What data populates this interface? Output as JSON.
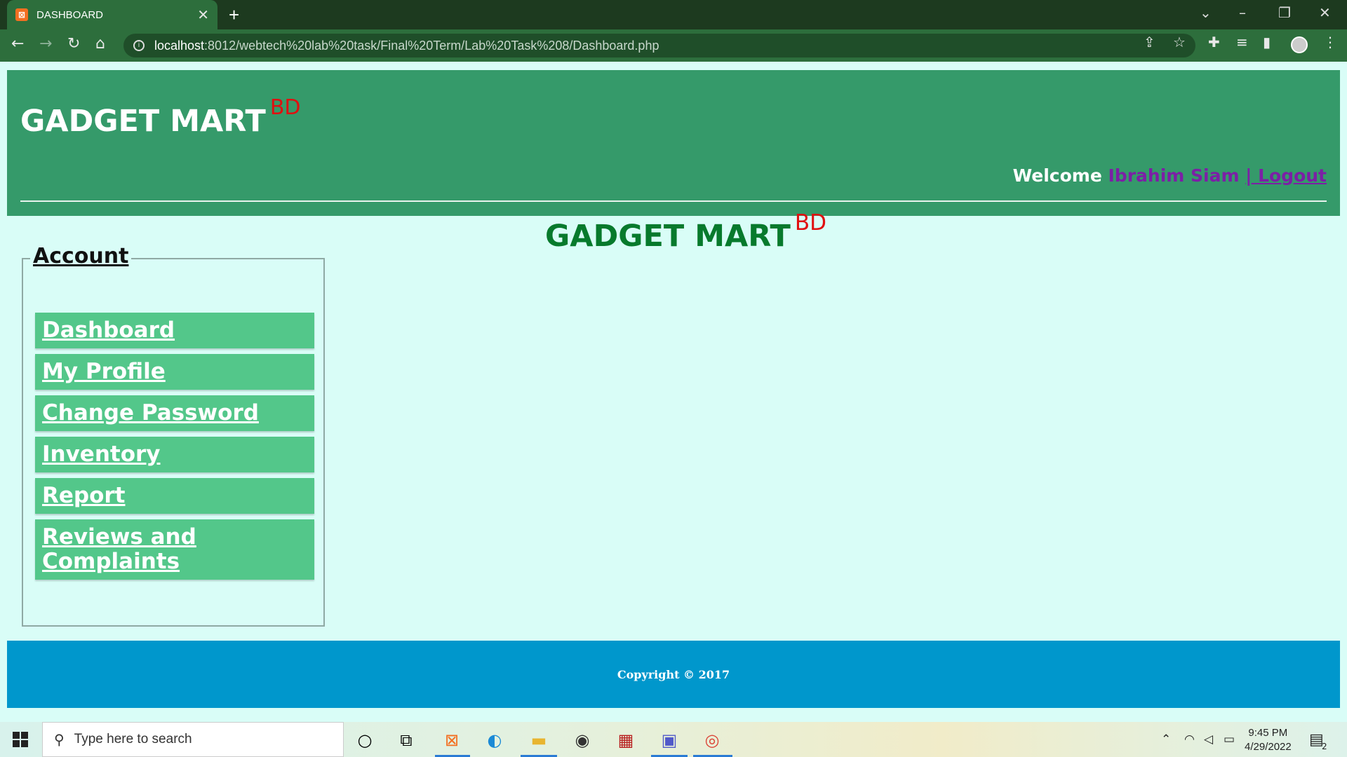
{
  "browser": {
    "tab_title": "DASHBOARD",
    "favicon_glyph": "⊠",
    "url_host": "localhost",
    "url_path": ":8012/webtech%20lab%20task/Final%20Term/Lab%20Task%208/Dashboard.php"
  },
  "header": {
    "logo_main": "GADGET MART",
    "logo_sup": "BD",
    "welcome_label": "Welcome",
    "user_name": "Ibrahim Siam",
    "logout_label": "| Logout"
  },
  "sidebar": {
    "legend": "Account",
    "items": [
      {
        "label": "Dashboard"
      },
      {
        "label": "My Profile"
      },
      {
        "label": "Change Password"
      },
      {
        "label": "Inventory"
      },
      {
        "label": "Report"
      },
      {
        "label": "Reviews and Complaints"
      }
    ]
  },
  "main": {
    "title_main": "GADGET MART",
    "title_sup": "BD"
  },
  "footer": {
    "copyright": "Copyright © 2017"
  },
  "taskbar": {
    "search_placeholder": "Type here to search",
    "time": "9:45 PM",
    "date": "4/29/2022",
    "notification_count": "2"
  },
  "colors": {
    "header_bg": "#359a6a",
    "menu_bg": "#53c78a",
    "page_bg": "#d9fdf7",
    "footer_bg": "#0097cc",
    "accent_red": "#e01010",
    "user_purple": "#7c1fa6",
    "title_green": "#077a2c"
  }
}
